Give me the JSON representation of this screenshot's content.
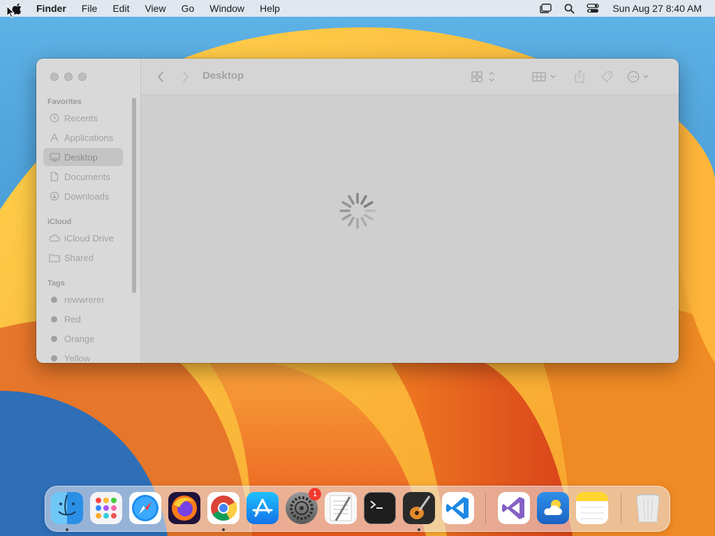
{
  "menubar": {
    "app_name": "Finder",
    "items": [
      "File",
      "Edit",
      "View",
      "Go",
      "Window",
      "Help"
    ],
    "clock": "Sun Aug 27  8:40 AM",
    "icons": [
      "apple-logo-icon",
      "stage-manager-icon",
      "spotlight-search-icon",
      "control-center-icon"
    ]
  },
  "finder": {
    "title": "Desktop",
    "sidebar": {
      "favorites_heading": "Favorites",
      "favorites": [
        {
          "label": "Recents",
          "icon": "clock-icon"
        },
        {
          "label": "Applications",
          "icon": "applications-icon"
        },
        {
          "label": "Desktop",
          "icon": "desktop-icon",
          "selected": true
        },
        {
          "label": "Documents",
          "icon": "document-icon"
        },
        {
          "label": "Downloads",
          "icon": "download-icon"
        }
      ],
      "icloud_heading": "iCloud",
      "icloud": [
        {
          "label": "iCloud Drive",
          "icon": "cloud-icon"
        },
        {
          "label": "Shared",
          "icon": "shared-folder-icon"
        }
      ],
      "tags_heading": "Tags",
      "tags": [
        {
          "label": "rewwrerer",
          "color": "#a0a0a0"
        },
        {
          "label": "Red",
          "color": "#a0a0a0"
        },
        {
          "label": "Orange",
          "color": "#a0a0a0"
        },
        {
          "label": "Yellow",
          "color": "#a0a0a0"
        }
      ]
    },
    "content_state": "loading"
  },
  "dock": {
    "apps": [
      "Finder",
      "Launchpad",
      "Safari",
      "Firefox",
      "Google Chrome",
      "App Store",
      "System Settings",
      "TextEdit",
      "Terminal",
      "GarageBand",
      "Visual Studio Code",
      "Visual Studio",
      "Weather",
      "Notes",
      "Trash"
    ],
    "settings_badge": "1"
  }
}
